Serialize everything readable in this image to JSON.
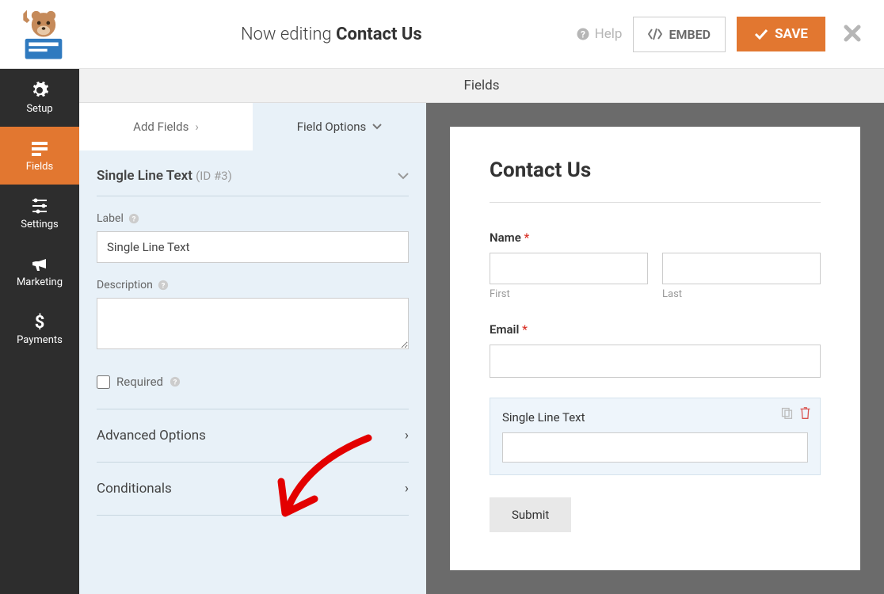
{
  "header": {
    "editing_prefix": "Now editing",
    "editing_name": "Contact Us",
    "help_label": "Help",
    "embed_label": "EMBED",
    "save_label": "SAVE"
  },
  "sidebar": {
    "setup": "Setup",
    "fields": "Fields",
    "settings": "Settings",
    "marketing": "Marketing",
    "payments": "Payments"
  },
  "fields_panel_title": "Fields",
  "tabs": {
    "add": "Add Fields",
    "options": "Field Options"
  },
  "field_opts": {
    "title": "Single Line Text",
    "id_text": "(ID #3)",
    "label_caption": "Label",
    "label_value": "Single Line Text",
    "description_caption": "Description",
    "description_value": "",
    "required_caption": "Required",
    "advanced": "Advanced Options",
    "conditionals": "Conditionals"
  },
  "preview": {
    "form_title": "Contact Us",
    "name_label": "Name",
    "first_sub": "First",
    "last_sub": "Last",
    "email_label": "Email",
    "selected_label": "Single Line Text",
    "submit": "Submit"
  }
}
